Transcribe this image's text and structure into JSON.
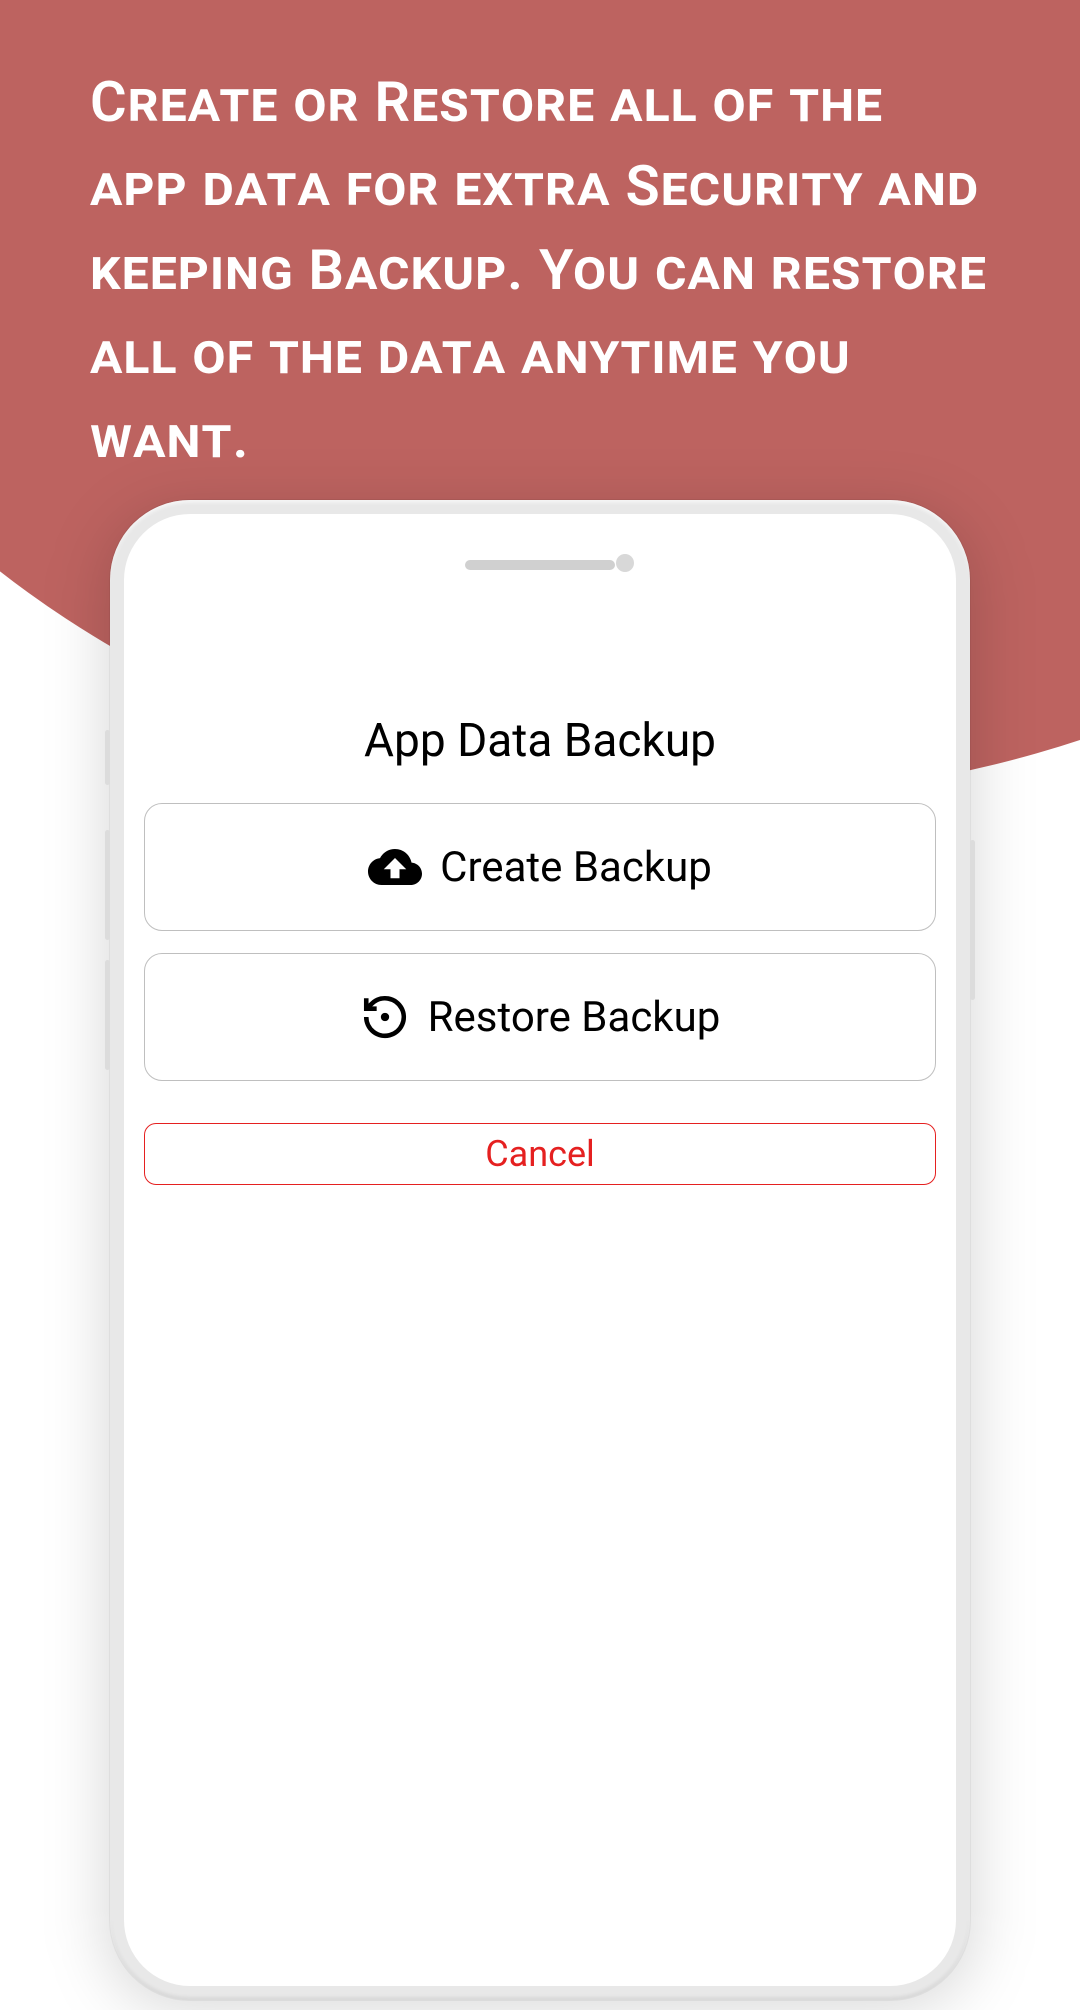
{
  "promo": {
    "headline": "Create or Restore all of the app data for extra Security and keeping Backup. You can restore all of the data anytime you want."
  },
  "dialog": {
    "title": "App Data Backup",
    "create_label": "Create Backup",
    "restore_label": "Restore Backup",
    "cancel_label": "Cancel"
  },
  "colors": {
    "accent": "#bd6360",
    "danger": "#e52020"
  }
}
